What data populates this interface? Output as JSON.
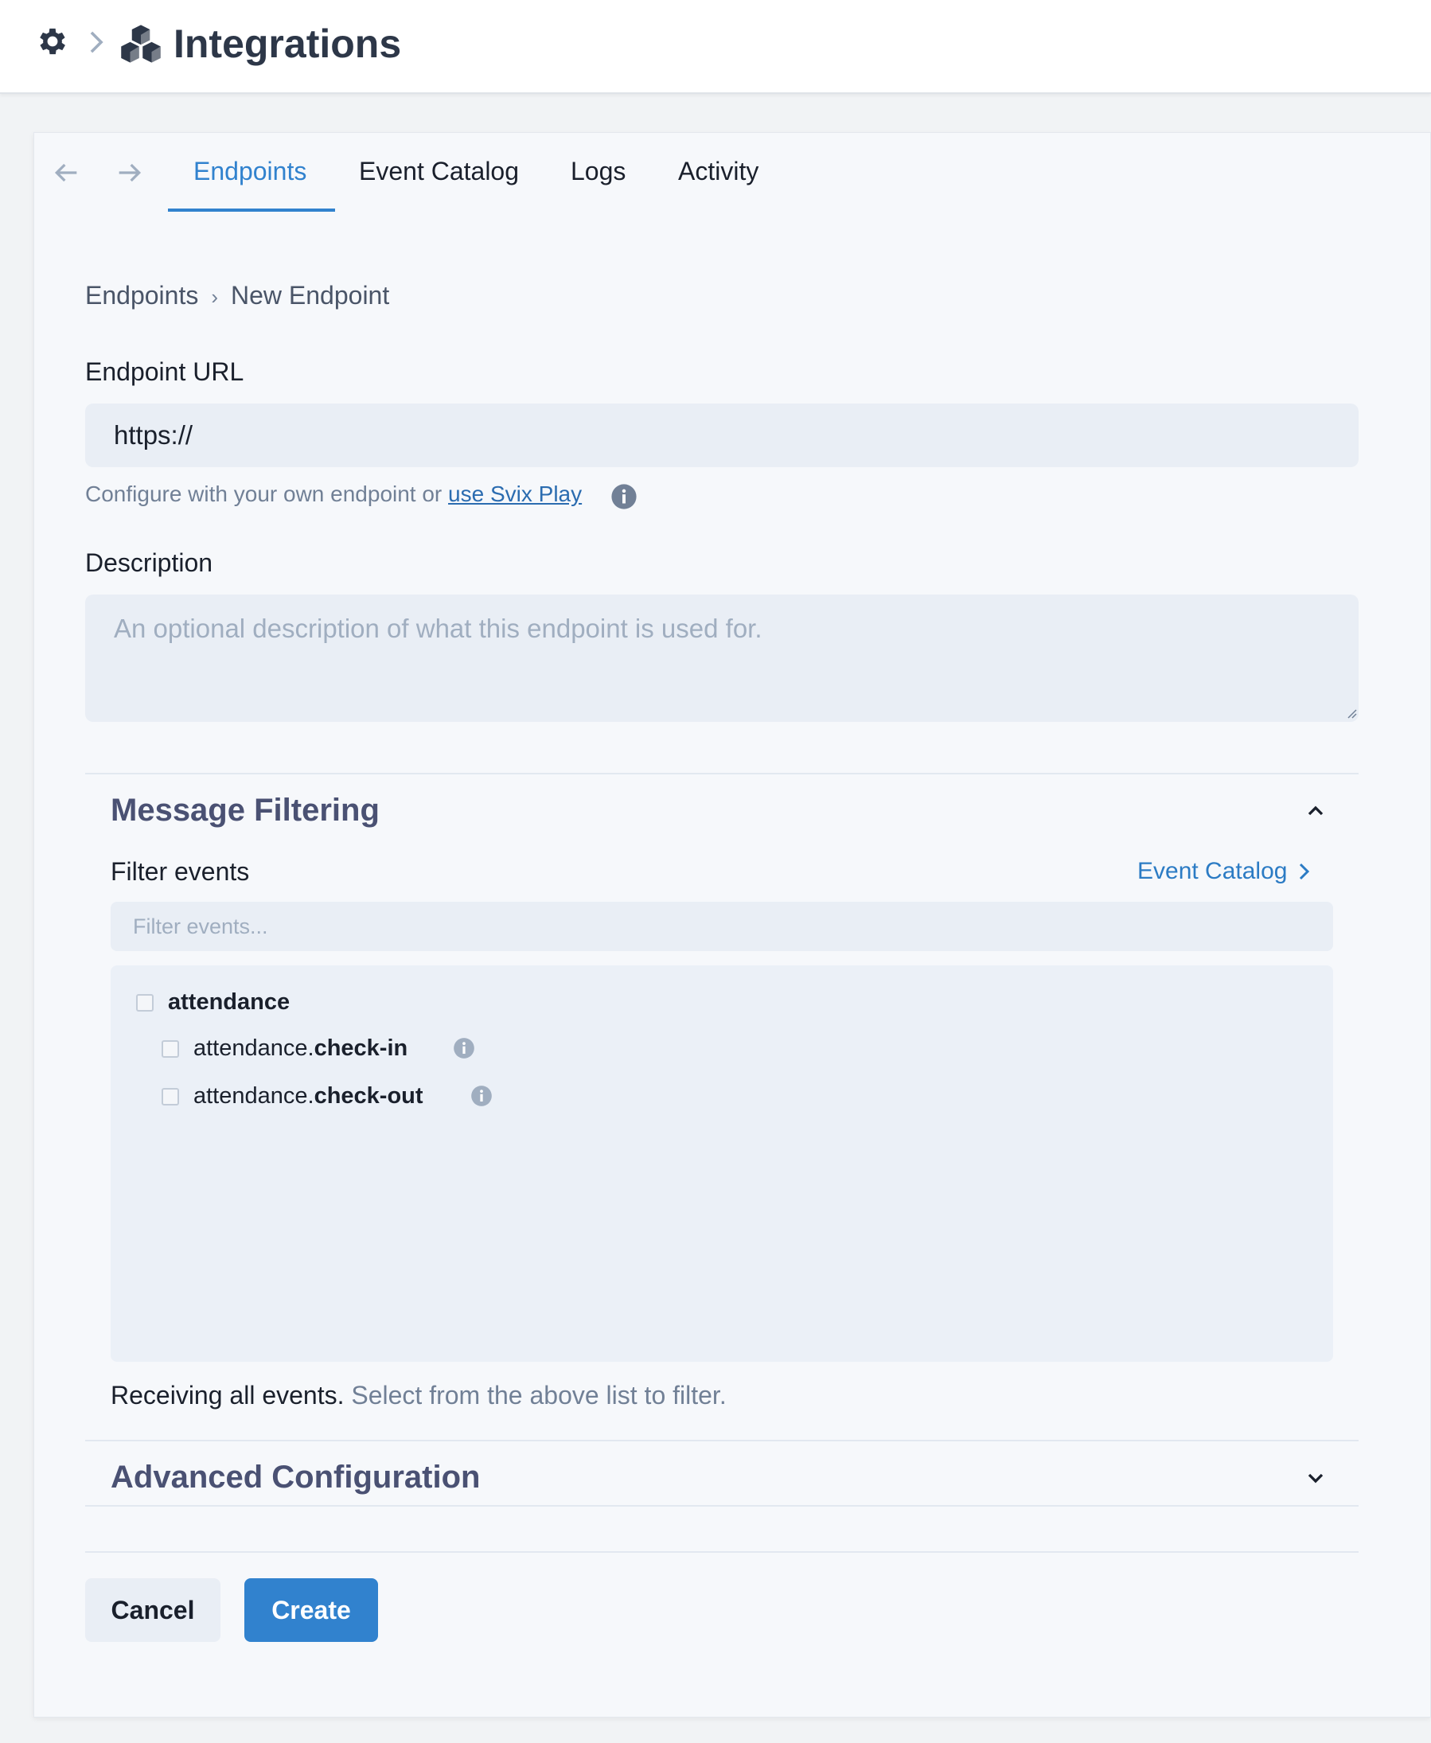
{
  "header": {
    "title": "Integrations",
    "icons": [
      "gear-icon",
      "chevron-right-icon",
      "cubes-icon"
    ]
  },
  "tabs": [
    {
      "label": "Endpoints",
      "active": true
    },
    {
      "label": "Event Catalog",
      "active": false
    },
    {
      "label": "Logs",
      "active": false
    },
    {
      "label": "Activity",
      "active": false
    }
  ],
  "breadcrumb": {
    "parent": "Endpoints",
    "separator": "›",
    "current": "New Endpoint"
  },
  "form": {
    "url_label": "Endpoint URL",
    "url_value": "https://",
    "helper_prefix": "Configure with your own endpoint or ",
    "helper_link": "use Svix Play",
    "description_label": "Description",
    "description_placeholder": "An optional description of what this endpoint is used for."
  },
  "message_filtering": {
    "title": "Message Filtering",
    "filter_label": "Filter events",
    "catalog_link": "Event Catalog",
    "filter_placeholder": "Filter events...",
    "groups": [
      {
        "name": "attendance",
        "events": [
          {
            "prefix": "attendance.",
            "name": "check-in"
          },
          {
            "prefix": "attendance.",
            "name": "check-out"
          }
        ]
      }
    ],
    "status_strong": "Receiving all events.",
    "status_muted": " Select from the above list to filter."
  },
  "advanced": {
    "title": "Advanced Configuration"
  },
  "actions": {
    "cancel": "Cancel",
    "create": "Create"
  },
  "colors": {
    "accent": "#3182ce",
    "link": "#2b6cb0",
    "section_title": "#4a5173"
  }
}
